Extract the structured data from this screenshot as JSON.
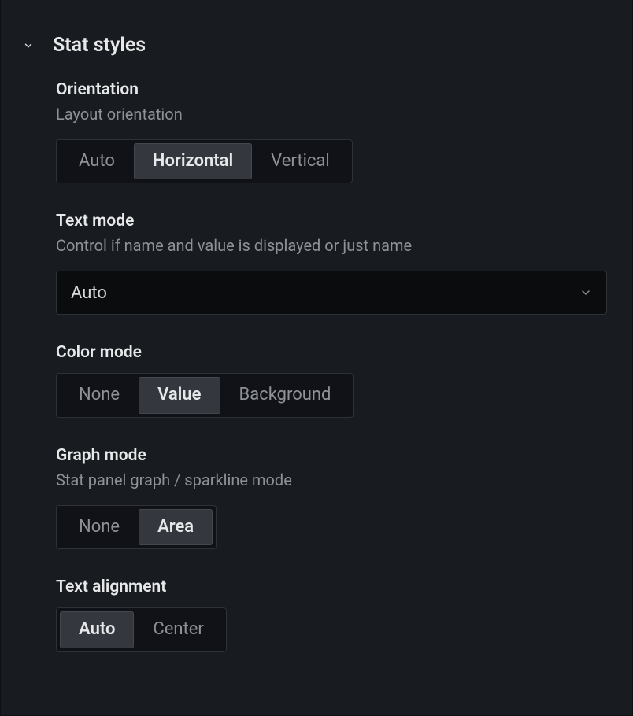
{
  "section": {
    "title": "Stat styles"
  },
  "orientation": {
    "label": "Orientation",
    "description": "Layout orientation",
    "options": {
      "auto": "Auto",
      "horizontal": "Horizontal",
      "vertical": "Vertical"
    },
    "selected": "horizontal"
  },
  "textMode": {
    "label": "Text mode",
    "description": "Control if name and value is displayed or just name",
    "value": "Auto"
  },
  "colorMode": {
    "label": "Color mode",
    "options": {
      "none": "None",
      "value": "Value",
      "background": "Background"
    },
    "selected": "value"
  },
  "graphMode": {
    "label": "Graph mode",
    "description": "Stat panel graph / sparkline mode",
    "options": {
      "none": "None",
      "area": "Area"
    },
    "selected": "area"
  },
  "textAlignment": {
    "label": "Text alignment",
    "options": {
      "auto": "Auto",
      "center": "Center"
    },
    "selected": "auto"
  }
}
